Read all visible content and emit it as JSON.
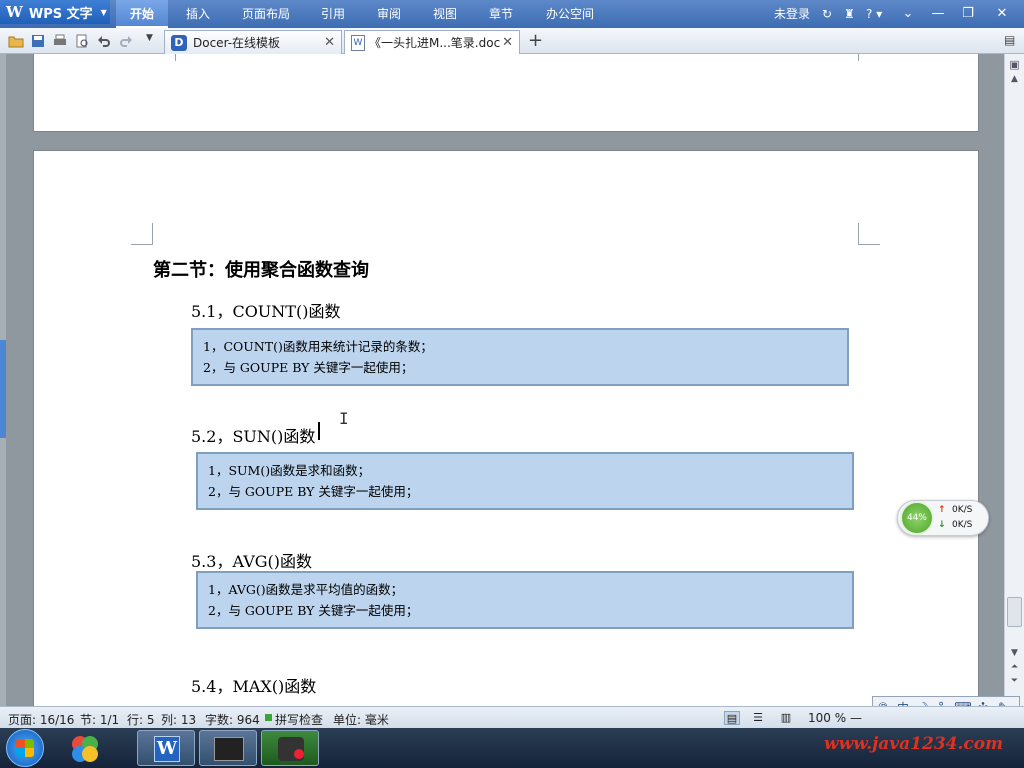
{
  "app": {
    "name": "WPS 文字",
    "logo_letter": "W",
    "accent": "#3d6db3"
  },
  "menu": [
    {
      "label": "开始",
      "active": true
    },
    {
      "label": "插入"
    },
    {
      "label": "页面布局"
    },
    {
      "label": "引用"
    },
    {
      "label": "审阅"
    },
    {
      "label": "视图"
    },
    {
      "label": "章节"
    },
    {
      "label": "办公空间"
    }
  ],
  "titlebar_right": {
    "login": "未登录",
    "help": "?"
  },
  "tabs": [
    {
      "label": "Docer-在线模板",
      "icon": "docer-icon"
    },
    {
      "label": "《一头扎进M...笔录.doc",
      "icon": "word-doc-icon",
      "active": true
    }
  ],
  "document": {
    "section_heading": "第二节：使用聚合函数查询",
    "sections": [
      {
        "title": "5.1，COUNT()函数",
        "lines": [
          "1，COUNT()函数用来统计记录的条数；",
          "2，与 GOUPE BY 关键字一起使用；"
        ]
      },
      {
        "title": "5.2，SUN()函数",
        "lines": [
          "1，SUM()函数是求和函数；",
          "2，与 GOUPE BY 关键字一起使用；"
        ]
      },
      {
        "title": "5.3，AVG()函数",
        "lines": [
          "1，AVG()函数是求平均值的函数；",
          "2，与 GOUPE BY 关键字一起使用；"
        ]
      },
      {
        "title": "5.4，MAX()函数"
      }
    ],
    "box_color": "#bcd4ee"
  },
  "net_monitor": {
    "cpu": "44%",
    "upload": "0K/S",
    "download": "0K/S"
  },
  "ime": {
    "mode": "中"
  },
  "statusbar": {
    "page": "页面: 16/16",
    "section": "节: 1/1",
    "row": "行: 5",
    "col": "列: 13",
    "words": "字数: 964",
    "spellcheck": "拼写检查",
    "unit": "单位: 毫米",
    "zoom": "100 %",
    "zoom_minus": "—"
  },
  "watermark": "www.java1234.com"
}
